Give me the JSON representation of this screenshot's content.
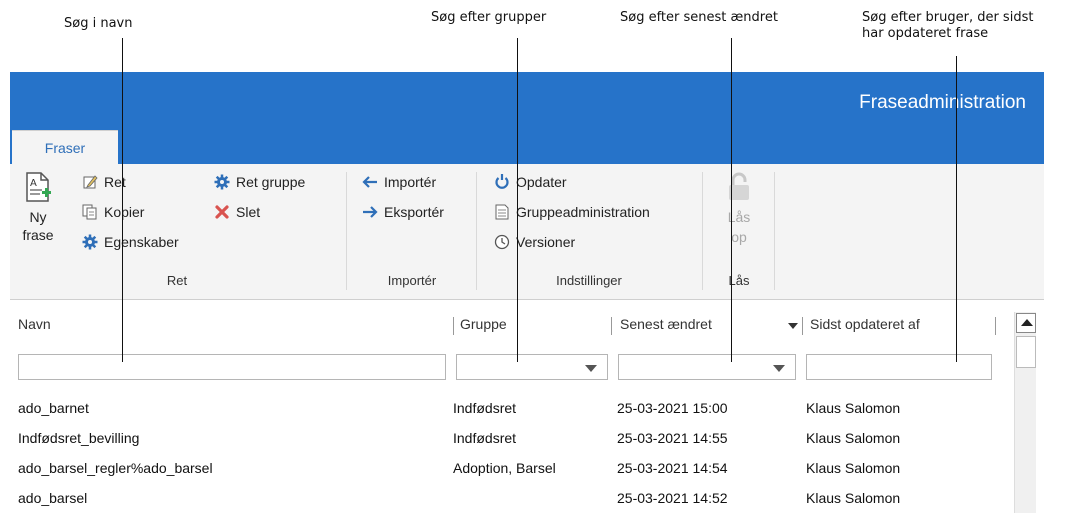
{
  "callouts": {
    "name_search": "Søg i navn",
    "group_search": "Søg efter grupper",
    "changed_search": "Søg efter senest ændret",
    "user_search_line1": "Søg efter bruger, der sidst",
    "user_search_line2": "har opdateret frase"
  },
  "window": {
    "title": "Fraseadministration",
    "tab": "Fraser",
    "accent_color": "#2673c9"
  },
  "ribbon": {
    "ret": {
      "new_line1": "Ny",
      "new_line2": "frase",
      "edit": "Ret",
      "copy": "Kopier",
      "properties": "Egenskaber",
      "edit_group": "Ret gruppe",
      "delete": "Slet",
      "label": "Ret"
    },
    "import": {
      "import": "Importér",
      "export": "Eksportér",
      "label": "Importér"
    },
    "settings": {
      "refresh": "Opdater",
      "group_admin": "Gruppeadministration",
      "versions": "Versioner",
      "label": "Indstillinger"
    },
    "lock": {
      "unlock_line1": "Lås",
      "unlock_line2": "op",
      "label": "Lås"
    }
  },
  "grid": {
    "columns": [
      "Navn",
      "Gruppe",
      "Senest ændret",
      "Sidst opdateret af"
    ],
    "rows": [
      [
        "ado_barnet",
        "Indfødsret",
        "25-03-2021 15:00",
        "Klaus Salomon"
      ],
      [
        "Indfødsret_bevilling",
        "Indfødsret",
        "25-03-2021 14:55",
        "Klaus Salomon"
      ],
      [
        "ado_barsel_regler%ado_barsel",
        "Adoption, Barsel",
        "25-03-2021 14:54",
        "Klaus Salomon"
      ],
      [
        "ado_barsel",
        "",
        "25-03-2021 14:52",
        "Klaus Salomon"
      ]
    ]
  }
}
